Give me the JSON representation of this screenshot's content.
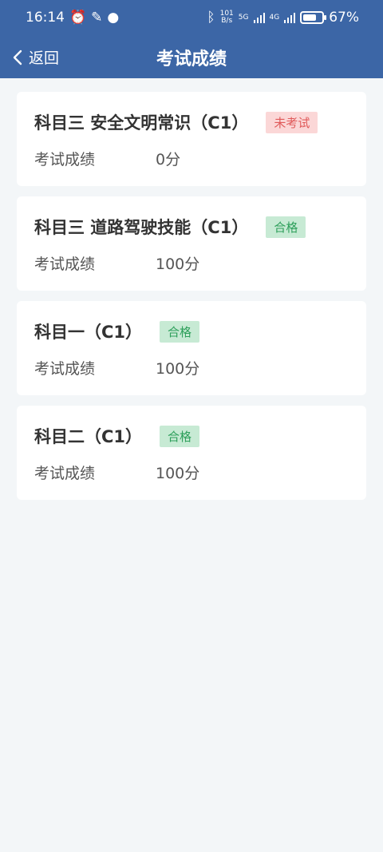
{
  "status_bar": {
    "time": "16:14",
    "net_speed_top": "101",
    "net_speed_bottom": "B/s",
    "sig1_label": "5G",
    "sig2_label": "4G",
    "battery": "67%"
  },
  "nav": {
    "back_label": "返回",
    "title": "考试成绩"
  },
  "cards": [
    {
      "name": "科目三 安全文明常识（C1）",
      "badge": "未考试",
      "status": "fail",
      "score_label": "考试成绩",
      "score": "0分"
    },
    {
      "name": "科目三 道路驾驶技能（C1）",
      "badge": "合格",
      "status": "pass",
      "score_label": "考试成绩",
      "score": "100分"
    },
    {
      "name": "科目一（C1）",
      "badge": "合格",
      "status": "pass",
      "score_label": "考试成绩",
      "score": "100分"
    },
    {
      "name": "科目二（C1）",
      "badge": "合格",
      "status": "pass",
      "score_label": "考试成绩",
      "score": "100分"
    }
  ],
  "colors": {
    "header_bg": "#3c66a6",
    "page_bg": "#f3f6f8",
    "pass_bg": "#c7ead4",
    "pass_text": "#2d9f5a",
    "fail_bg": "#fbd7d7",
    "fail_text": "#e05a5a"
  }
}
